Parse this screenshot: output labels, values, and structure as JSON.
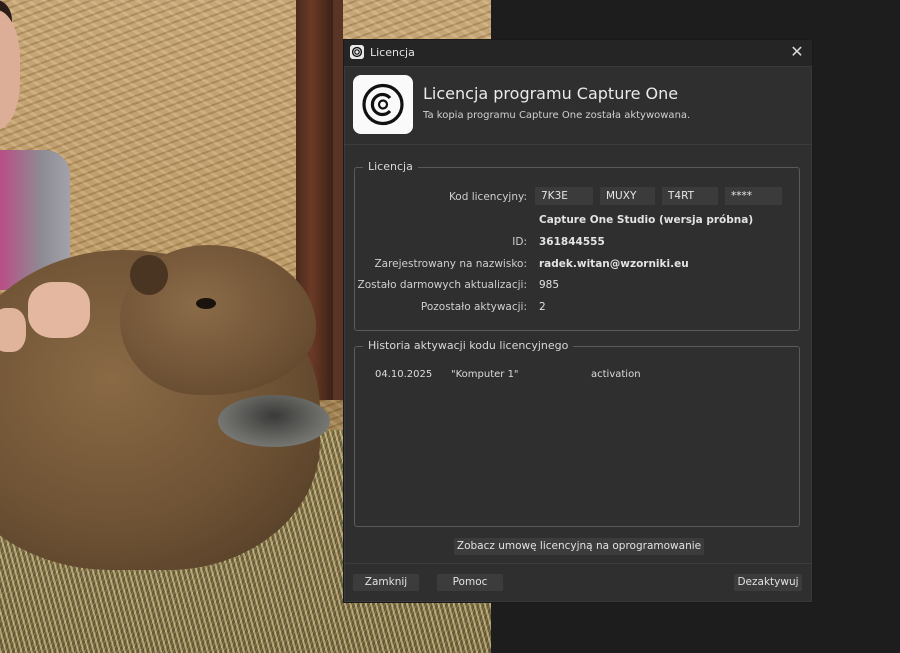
{
  "window": {
    "title": "Licencja",
    "close_glyph": "✕",
    "app_icon": "capture-one-icon"
  },
  "header": {
    "title": "Licencja programu Capture One",
    "subtitle": "Ta kopia programu Capture One została aktywowana."
  },
  "license": {
    "legend": "Licencja",
    "key_label": "Kod licencyjny:",
    "key_parts": [
      "7K3E",
      "MUXY",
      "T4RT",
      "****"
    ],
    "product": "Capture One Studio (wersja próbna)",
    "id_label": "ID:",
    "id_value": "361844555",
    "registered_label": "Zarejestrowany na nazwisko:",
    "registered_value": "radek.witan@wzorniki.eu",
    "updates_label": "Zostało darmowych aktualizacji:",
    "updates_value": "985",
    "activations_label": "Pozostało aktywacji:",
    "activations_value": "2"
  },
  "history": {
    "legend": "Historia aktywacji kodu licencyjnego",
    "rows": [
      {
        "date": "04.10.2025",
        "computer": "\"Komputer 1\"",
        "action": "activation"
      }
    ]
  },
  "buttons": {
    "eula": "Zobacz umowę licencyjną na oprogramowanie",
    "close": "Zamknij",
    "help": "Pomoc",
    "deactivate": "Dezaktywuj"
  },
  "colors": {
    "dialog_bg": "#2f2f2f",
    "titlebar_bg": "#252525",
    "button_bg": "#3c3c3c",
    "group_border": "#5a5a5a"
  }
}
